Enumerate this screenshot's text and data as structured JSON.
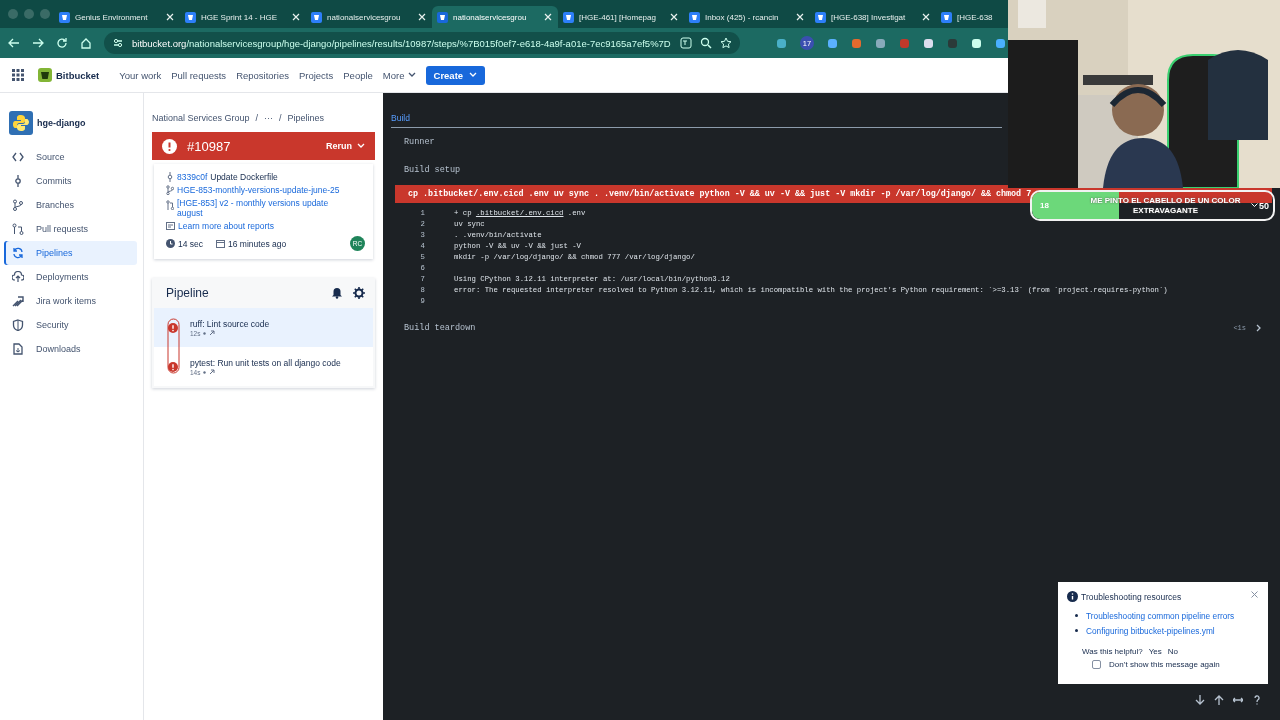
{
  "browser": {
    "tabs": [
      {
        "title": "Genius Environment",
        "selected": false,
        "close": true
      },
      {
        "title": "HGE Sprint 14 - HGE",
        "selected": false,
        "close": true
      },
      {
        "title": "nationalservicesgrou",
        "selected": false,
        "close": true
      },
      {
        "title": "nationalservicesgrou",
        "selected": true,
        "close": true
      },
      {
        "title": "[HGE-461] [Homepag",
        "selected": false,
        "close": true
      },
      {
        "title": "Inbox (425) - rcancin",
        "selected": false,
        "close": true
      },
      {
        "title": "[HGE-638] Investigat",
        "selected": false,
        "close": true
      },
      {
        "title": "[HGE-638",
        "selected": false,
        "close": false
      }
    ],
    "url_host": "bitbucket.org",
    "url_path": "/nationalservicesgroup/hge-django/pipelines/results/10987/steps/%7B015f0ef7-e618-4a9f-a01e-7ec9165a7ef5%7D",
    "extension_badge": "17"
  },
  "nav": {
    "product": "Bitbucket",
    "items": [
      "Your work",
      "Pull requests",
      "Repositories",
      "Projects",
      "People"
    ],
    "more": "More",
    "create": "Create"
  },
  "sidebar": {
    "repo": "hge-django",
    "items": [
      {
        "label": "Source",
        "selected": false
      },
      {
        "label": "Commits",
        "selected": false
      },
      {
        "label": "Branches",
        "selected": false
      },
      {
        "label": "Pull requests",
        "selected": false
      },
      {
        "label": "Pipelines",
        "selected": true
      },
      {
        "label": "Deployments",
        "selected": false
      },
      {
        "label": "Jira work items",
        "selected": false
      },
      {
        "label": "Security",
        "selected": false
      },
      {
        "label": "Downloads",
        "selected": false
      }
    ]
  },
  "breadcrumbs": {
    "separator": "/",
    "items": [
      "National Services Group",
      "···",
      "Pipelines"
    ]
  },
  "run": {
    "number": "#10987",
    "failed": true,
    "action": "Rerun",
    "commit_hash": "8339c0f",
    "commit_message": "Update Dockerfile",
    "branch": "HGE-853-monthly-versions-update-june-25",
    "pull_request": "[HGE-853] v2 - monthly versions update august",
    "reports_link": "Learn more about reports",
    "duration": "14 sec",
    "time": "16 minutes ago",
    "author": "RC"
  },
  "steps_panel": {
    "title": "Pipeline",
    "steps": [
      {
        "name": "ruff: Lint source code",
        "duration": "12s",
        "failed": true,
        "selected": true
      },
      {
        "name": "pytest: Run unit tests on all django code",
        "duration": "14s",
        "failed": true,
        "selected": false
      }
    ]
  },
  "log": {
    "tabs": [
      {
        "label": "Build",
        "selected": true
      }
    ],
    "sections": [
      {
        "kind": "step",
        "title": "Runner"
      },
      {
        "kind": "step",
        "title": "Build setup"
      },
      {
        "kind": "error",
        "command": "cp .bitbucket/.env.cicd .env uv sync . .venv/bin/activate python -V && uv -V && just -V mkdir -p /var/log/django/ && chmod 7",
        "lines": [
          {
            "number": "1",
            "prefix": "+ cp ",
            "link": ".bitbucket/.env.cicd",
            "text": " .env"
          },
          {
            "number": "2",
            "text": "uv sync"
          },
          {
            "number": "3",
            "text": ". .venv/bin/activate"
          },
          {
            "number": "4",
            "text": "python -V && uv -V && just -V"
          },
          {
            "number": "5",
            "text": "mkdir -p /var/log/django/ && chmod 777 /var/log/django/"
          },
          {
            "number": "6"
          },
          {
            "number": "7",
            "text": "Using CPython 3.12.11 interpreter at: /usr/local/bin/python3.12"
          },
          {
            "number": "8",
            "text": "error: The requested interpreter resolved to Python 3.12.11, which is incompatible with the project's Python requirement: `>=3.13` (from `project.requires-python`)"
          },
          {
            "number": "9"
          }
        ]
      },
      {
        "kind": "step",
        "title": "Build teardown",
        "duration": "<1s"
      }
    ]
  },
  "help_popup": {
    "title": "Troubleshooting resources",
    "links": [
      "Troubleshooting common pipeline errors",
      "Configuring bitbucket-pipelines.yml"
    ],
    "question": "Was this helpful?",
    "answers": [
      "Yes",
      "No"
    ],
    "checkbox": {
      "label": "Don’t show this message again",
      "checked": false
    }
  },
  "stream_overlay": {
    "count": "18",
    "title": "ME PINTO EL CABELLO DE UN COLOR EXTRAVAGANTE",
    "goal": "50",
    "level": 0.36
  }
}
